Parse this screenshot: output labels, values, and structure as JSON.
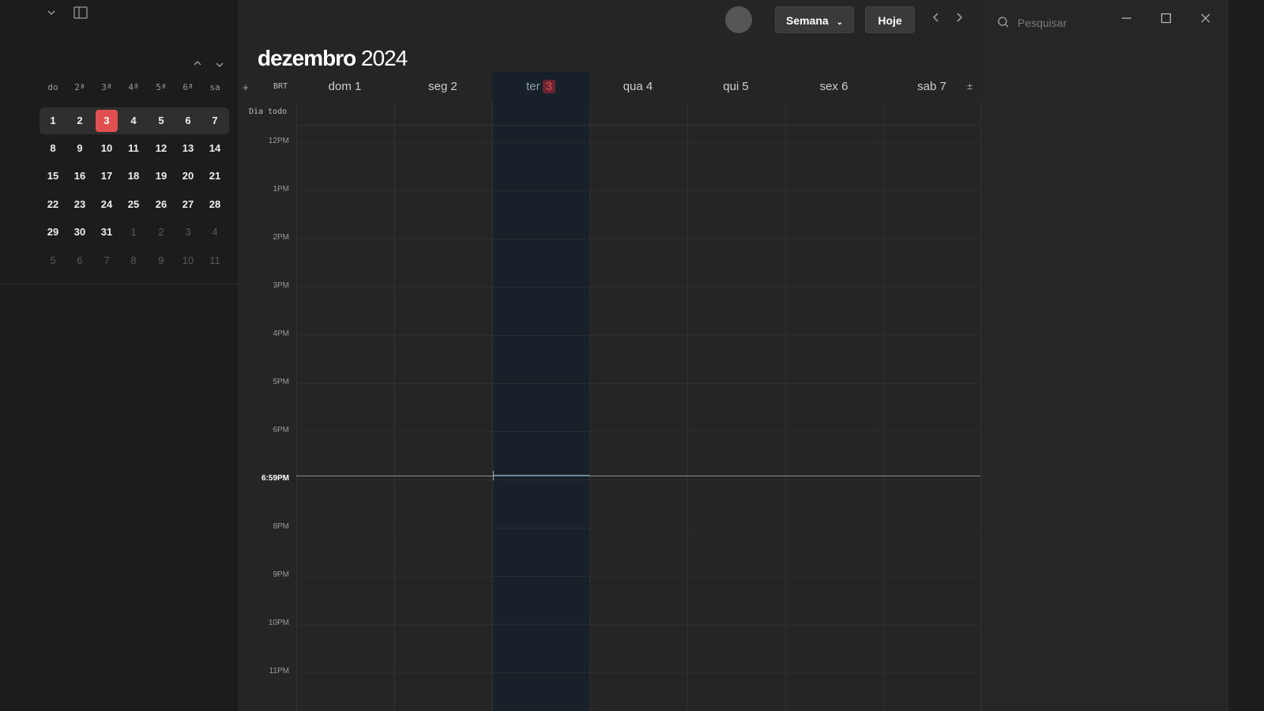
{
  "sidebar": {
    "weekday_heads": [
      "do",
      "2ª",
      "3ª",
      "4ª",
      "5ª",
      "6ª",
      "sa"
    ],
    "weeks": [
      [
        {
          "d": "1"
        },
        {
          "d": "2"
        },
        {
          "d": "3",
          "today": true
        },
        {
          "d": "4"
        },
        {
          "d": "5"
        },
        {
          "d": "6"
        },
        {
          "d": "7"
        }
      ],
      [
        {
          "d": "8"
        },
        {
          "d": "9"
        },
        {
          "d": "10"
        },
        {
          "d": "11"
        },
        {
          "d": "12"
        },
        {
          "d": "13"
        },
        {
          "d": "14"
        }
      ],
      [
        {
          "d": "15"
        },
        {
          "d": "16"
        },
        {
          "d": "17"
        },
        {
          "d": "18"
        },
        {
          "d": "19"
        },
        {
          "d": "20"
        },
        {
          "d": "21"
        }
      ],
      [
        {
          "d": "22"
        },
        {
          "d": "23"
        },
        {
          "d": "24"
        },
        {
          "d": "25"
        },
        {
          "d": "26"
        },
        {
          "d": "27"
        },
        {
          "d": "28"
        }
      ],
      [
        {
          "d": "29"
        },
        {
          "d": "30"
        },
        {
          "d": "31"
        },
        {
          "d": "1",
          "other": true
        },
        {
          "d": "2",
          "other": true
        },
        {
          "d": "3",
          "other": true
        },
        {
          "d": "4",
          "other": true
        }
      ],
      [
        {
          "d": "5",
          "other": true
        },
        {
          "d": "6",
          "other": true
        },
        {
          "d": "7",
          "other": true
        },
        {
          "d": "8",
          "other": true
        },
        {
          "d": "9",
          "other": true
        },
        {
          "d": "10",
          "other": true
        },
        {
          "d": "11",
          "other": true
        }
      ]
    ]
  },
  "header": {
    "month": "dezembro",
    "year": "2024",
    "view_label": "Semana",
    "today_label": "Hoje",
    "search_placeholder": "Pesquisar"
  },
  "grid": {
    "timezone": "BRT",
    "all_day_label": "Dia todo",
    "plus": "+",
    "collapse": "±",
    "days": [
      {
        "label": "dom 1"
      },
      {
        "label": "seg 2"
      },
      {
        "label": "ter",
        "num": "3",
        "today": true
      },
      {
        "label": "qua 4"
      },
      {
        "label": "qui 5"
      },
      {
        "label": "sex 6"
      },
      {
        "label": "sab 7"
      }
    ],
    "hours": [
      "12PM",
      "1PM",
      "2PM",
      "3PM",
      "4PM",
      "5PM",
      "6PM",
      "6:59PM",
      "8PM",
      "9PM",
      "10PM",
      "11PM"
    ],
    "now_label": "6:59PM"
  },
  "colors": {
    "today_accent": "#e05050",
    "today_column": "#18202a"
  }
}
